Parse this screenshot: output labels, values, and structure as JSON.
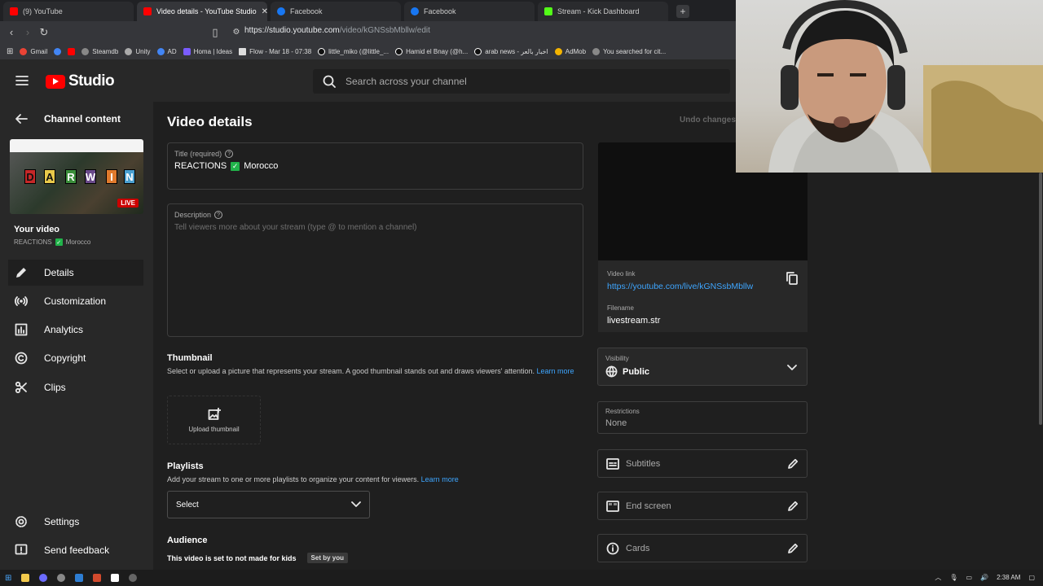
{
  "browser": {
    "tabs": [
      {
        "title": "(9) YouTube",
        "color": "#ff0000",
        "active": false
      },
      {
        "title": "Video details - YouTube Studio",
        "color": "#ff0000",
        "active": true
      },
      {
        "title": "Facebook",
        "color": "#1877f2",
        "active": false
      },
      {
        "title": "Facebook",
        "color": "#1877f2",
        "active": false
      },
      {
        "title": "Stream - Kick Dashboard",
        "color": "#53fc18",
        "active": false
      }
    ],
    "url_host": "https://studio.youtube.com",
    "url_path": "/video/kGNSsbMbllw/edit",
    "bookmarks": [
      "Gmail",
      "Steamdb",
      "Unity",
      "AD",
      "Homa | Ideas",
      "Flow - Mar 18 - 07:38",
      "little_miko (@little_...",
      "Hamid el Bnay (@h...",
      "arab news - اخبار بالعر",
      "AdMob",
      "You searched for cit..."
    ]
  },
  "header": {
    "logo_text": "Studio",
    "search_placeholder": "Search across your channel"
  },
  "sidebar": {
    "back_label": "Channel content",
    "live_badge": "LIVE",
    "thumb_letters": [
      "D",
      "A",
      "R",
      "W",
      "I",
      "N"
    ],
    "your_video": "Your video",
    "video_title_a": "REACTIONS",
    "video_title_b": "Morocco",
    "nav": [
      {
        "label": "Details",
        "icon": "pencil-icon"
      },
      {
        "label": "Customization",
        "icon": "broadcast-icon"
      },
      {
        "label": "Analytics",
        "icon": "analytics-icon"
      },
      {
        "label": "Copyright",
        "icon": "copyright-icon"
      },
      {
        "label": "Clips",
        "icon": "scissors-icon"
      }
    ],
    "settings": "Settings",
    "feedback": "Send feedback"
  },
  "main": {
    "page_title": "Video details",
    "undo": "Undo changes",
    "title_label": "Title (required)",
    "title_a": "REACTIONS",
    "title_b": "Morocco",
    "desc_label": "Description",
    "desc_placeholder": "Tell viewers more about your stream (type @ to mention a channel)",
    "thumbnail_heading": "Thumbnail",
    "thumbnail_desc": "Select or upload a picture that represents your stream. A good thumbnail stands out and draws viewers' attention.",
    "thumbnail_link": "Learn more",
    "upload_label": "Upload thumbnail",
    "playlists_heading": "Playlists",
    "playlists_desc": "Add your stream to one or more playlists to organize your content for viewers.",
    "playlists_link": "Learn more",
    "playlist_select": "Select",
    "audience_heading": "Audience",
    "audience_text": "This video is set to not made for kids",
    "audience_badge": "Set by you"
  },
  "right": {
    "video_link_label": "Video link",
    "video_link": "https://youtube.com/live/kGNSsbMbllw",
    "filename_label": "Filename",
    "filename": "livestream.str",
    "visibility_label": "Visibility",
    "visibility_value": "Public",
    "restrictions_label": "Restrictions",
    "restrictions_value": "None",
    "subtitles": "Subtitles",
    "end_screen": "End screen",
    "cards": "Cards"
  },
  "taskbar": {
    "time": "2:38 AM"
  },
  "colors": {
    "accent_link": "#3ea6ff",
    "yt_red": "#ff0000",
    "check_green": "#21b34a"
  }
}
